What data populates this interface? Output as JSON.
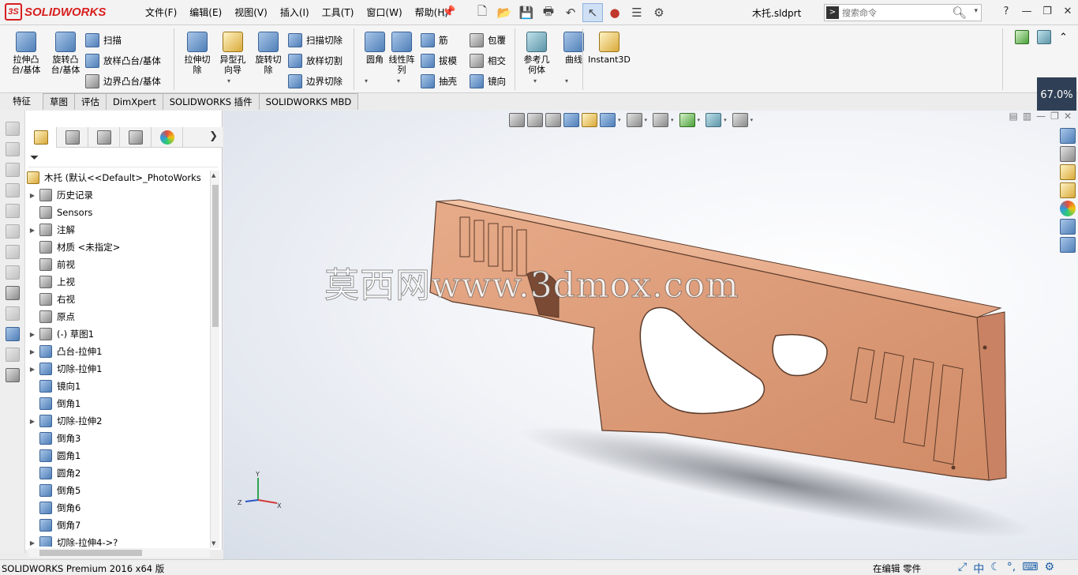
{
  "app": {
    "brand": "SOLIDWORKS",
    "doc_title": "木托.sldprt",
    "menu": [
      "文件(F)",
      "编辑(E)",
      "视图(V)",
      "插入(I)",
      "工具(T)",
      "窗口(W)",
      "帮助(H)"
    ],
    "search_placeholder": "搜索命令",
    "help": "?",
    "zoom": "67.0%"
  },
  "ribbon": {
    "big": [
      {
        "label": "拉伸凸\n台/基体",
        "icon": "extrude-boss-icon"
      },
      {
        "label": "旋转凸\n台/基体",
        "icon": "revolve-boss-icon"
      },
      {
        "label": "拉伸切\n除",
        "icon": "extrude-cut-icon"
      },
      {
        "label": "异型孔\n向导",
        "icon": "hole-wizard-icon"
      },
      {
        "label": "旋转切\n除",
        "icon": "revolve-cut-icon"
      },
      {
        "label": "圆角",
        "icon": "fillet-icon"
      },
      {
        "label": "线性阵\n列",
        "icon": "linear-pattern-icon"
      },
      {
        "label": "参考几\n何体",
        "icon": "reference-geometry-icon"
      },
      {
        "label": "曲线",
        "icon": "curves-icon"
      },
      {
        "label": "Instant3D",
        "icon": "instant3d-icon"
      }
    ],
    "small": [
      "扫描",
      "放样凸台/基体",
      "边界凸台/基体",
      "扫描切除",
      "放样切割",
      "边界切除",
      "筋",
      "拔模",
      "抽壳",
      "包覆",
      "相交",
      "镜向"
    ]
  },
  "tabs": [
    "特征",
    "草图",
    "评估",
    "DimXpert",
    "SOLIDWORKS 插件",
    "SOLIDWORKS MBD"
  ],
  "tree": {
    "root": "木托 (默认<<Default>_PhotoWorks",
    "items": [
      {
        "label": "历史记录",
        "icon": "history-icon",
        "exp": true
      },
      {
        "label": "Sensors",
        "icon": "sensors-icon",
        "exp": false
      },
      {
        "label": "注解",
        "icon": "annotations-icon",
        "exp": true
      },
      {
        "label": "材质 <未指定>",
        "icon": "material-icon",
        "exp": false
      },
      {
        "label": "前视",
        "icon": "plane-icon",
        "exp": false
      },
      {
        "label": "上视",
        "icon": "plane-icon",
        "exp": false
      },
      {
        "label": "右视",
        "icon": "plane-icon",
        "exp": false
      },
      {
        "label": "原点",
        "icon": "origin-icon",
        "exp": false
      },
      {
        "label": "(-) 草图1",
        "icon": "sketch-icon",
        "exp": true
      },
      {
        "label": "凸台-拉伸1",
        "icon": "boss-extrude-icon",
        "exp": true
      },
      {
        "label": "切除-拉伸1",
        "icon": "cut-extrude-icon",
        "exp": true
      },
      {
        "label": "镜向1",
        "icon": "mirror-icon",
        "exp": false
      },
      {
        "label": "倒角1",
        "icon": "chamfer-icon",
        "exp": false
      },
      {
        "label": "切除-拉伸2",
        "icon": "cut-extrude-icon",
        "exp": true
      },
      {
        "label": "倒角3",
        "icon": "chamfer-icon",
        "exp": false
      },
      {
        "label": "圆角1",
        "icon": "fillet-icon",
        "exp": false
      },
      {
        "label": "圆角2",
        "icon": "fillet-icon",
        "exp": false
      },
      {
        "label": "倒角5",
        "icon": "chamfer-icon",
        "exp": false
      },
      {
        "label": "倒角6",
        "icon": "chamfer-icon",
        "exp": false
      },
      {
        "label": "倒角7",
        "icon": "chamfer-icon",
        "exp": false
      },
      {
        "label": "切除-拉伸4->?",
        "icon": "cut-extrude-icon",
        "exp": true
      }
    ]
  },
  "graphics": {
    "watermark": "莫西网www.3dmox.com",
    "part_color": "#e0a07e",
    "triad": {
      "x": "X",
      "y": "Y",
      "z": "Z"
    }
  },
  "status": {
    "version": "SOLIDWORKS Premium 2016 x64 版",
    "mode": "在编辑 零件"
  }
}
